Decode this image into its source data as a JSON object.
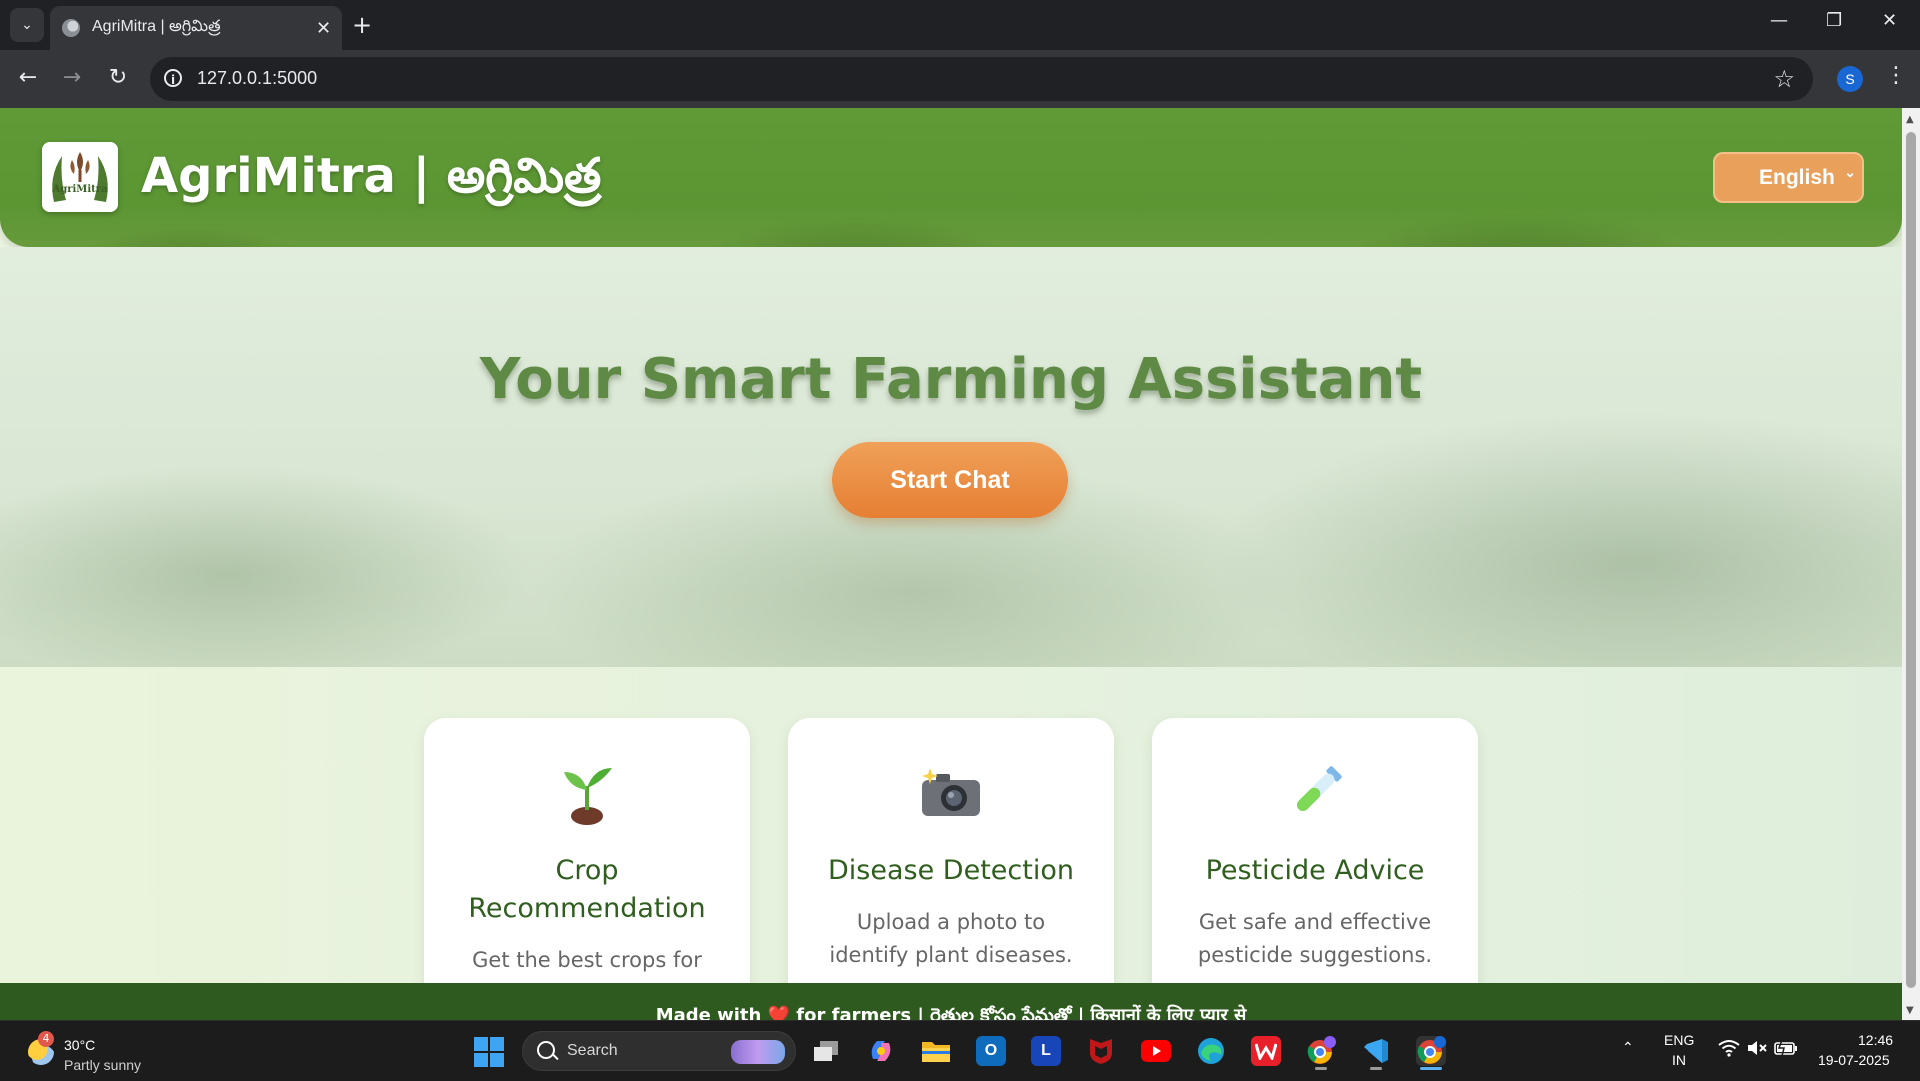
{
  "browser": {
    "tab_title": "AgriMitra | అగ్రిమిత్ర",
    "new_tab_icon": "+",
    "url": "127.0.0.1:5000",
    "profile_initial": "S"
  },
  "header": {
    "logo_text": "AgriMitra",
    "brand": "AgriMitra | అగ్రిమిత్ర",
    "language_selected": "English"
  },
  "hero": {
    "title": "Your Smart Farming Assistant",
    "cta": "Start Chat"
  },
  "features": [
    {
      "icon": "seedling-icon",
      "emoji": "🌱",
      "title": "Crop Recommendation",
      "description": "Get the best crops for your climate and soil."
    },
    {
      "icon": "camera-icon",
      "emoji": "📷",
      "title": "Disease Detection",
      "description": "Upload a photo to identify plant diseases."
    },
    {
      "icon": "test-tube-icon",
      "emoji": "🧪",
      "title": "Pesticide Advice",
      "description": "Get safe and effective pesticide suggestions."
    }
  ],
  "footer": {
    "text": "Made with ❤️ for farmers | రైతుల కోసం ప్రేమతో | किसानों के लिए प्यार से"
  },
  "taskbar": {
    "weather_badge": "4",
    "temperature": "30°C",
    "condition": "Partly sunny",
    "search_label": "Search",
    "app_l_letter": "L",
    "app_o_letter": "O",
    "language_top": "ENG",
    "language_bottom": "IN",
    "time": "12:46",
    "date": "19-07-2025"
  },
  "colors": {
    "header_green": "#5f9a37",
    "accent_orange": "#e57f33",
    "card_title_green": "#2f5e1f",
    "footer_green": "#2f5a1f"
  }
}
